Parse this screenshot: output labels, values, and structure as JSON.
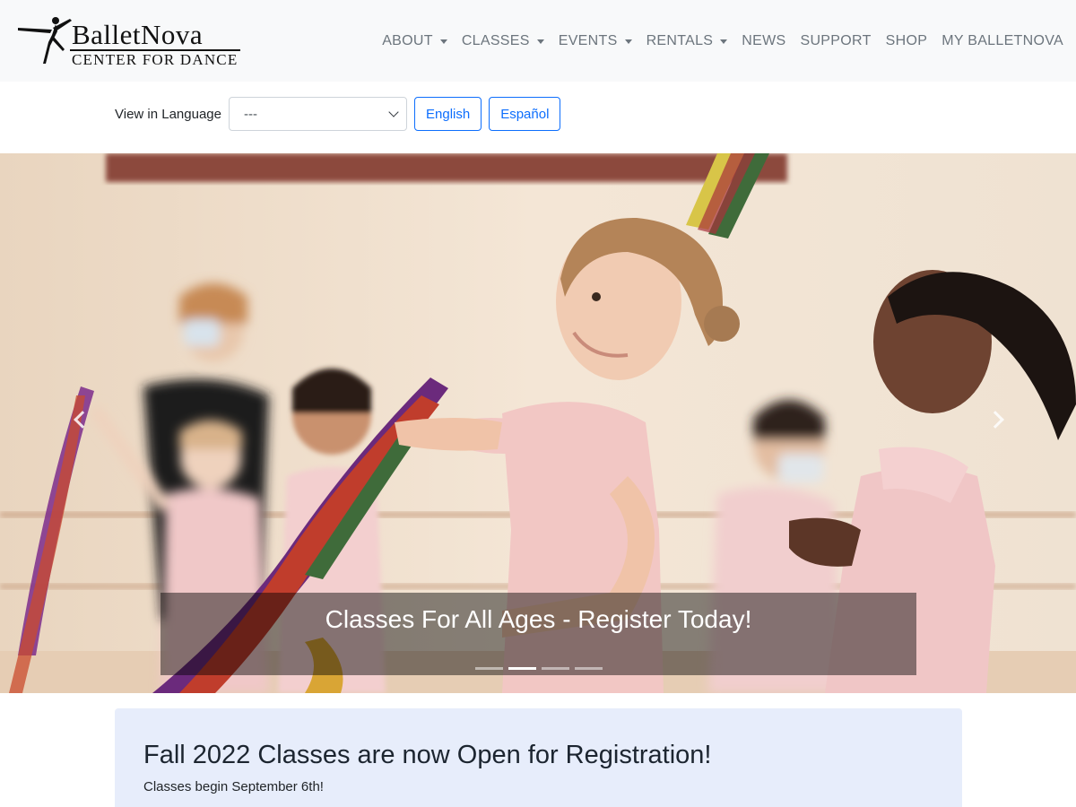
{
  "brand": {
    "title": "BalletNova",
    "subtitle": "CENTER FOR DANCE"
  },
  "nav": [
    {
      "label": "ABOUT",
      "dropdown": true
    },
    {
      "label": "CLASSES",
      "dropdown": true
    },
    {
      "label": "EVENTS",
      "dropdown": true
    },
    {
      "label": "RENTALS",
      "dropdown": true
    },
    {
      "label": "NEWS",
      "dropdown": false
    },
    {
      "label": "SUPPORT",
      "dropdown": false
    },
    {
      "label": "SHOP",
      "dropdown": false
    },
    {
      "label": "MY BALLETNOVA",
      "dropdown": false
    }
  ],
  "language": {
    "label": "View in Language",
    "selected": "---",
    "buttons": [
      "English",
      "Español"
    ]
  },
  "carousel": {
    "caption": "Classes For All Ages - Register Today!",
    "slide_count": 4,
    "active_slide": 2
  },
  "alert": {
    "title": "Fall 2022 Classes are now Open for Registration!",
    "subtitle": "Classes begin September 6th!"
  },
  "colors": {
    "primary": "#0d6efd",
    "navbar_bg": "#f8f9fa",
    "nav_text": "#6c757d",
    "alert_bg": "#e7edfb"
  },
  "icons": {
    "dropdown": "caret-down-icon",
    "select": "chevron-down-icon",
    "prev": "chevron-left-icon",
    "next": "chevron-right-icon"
  }
}
